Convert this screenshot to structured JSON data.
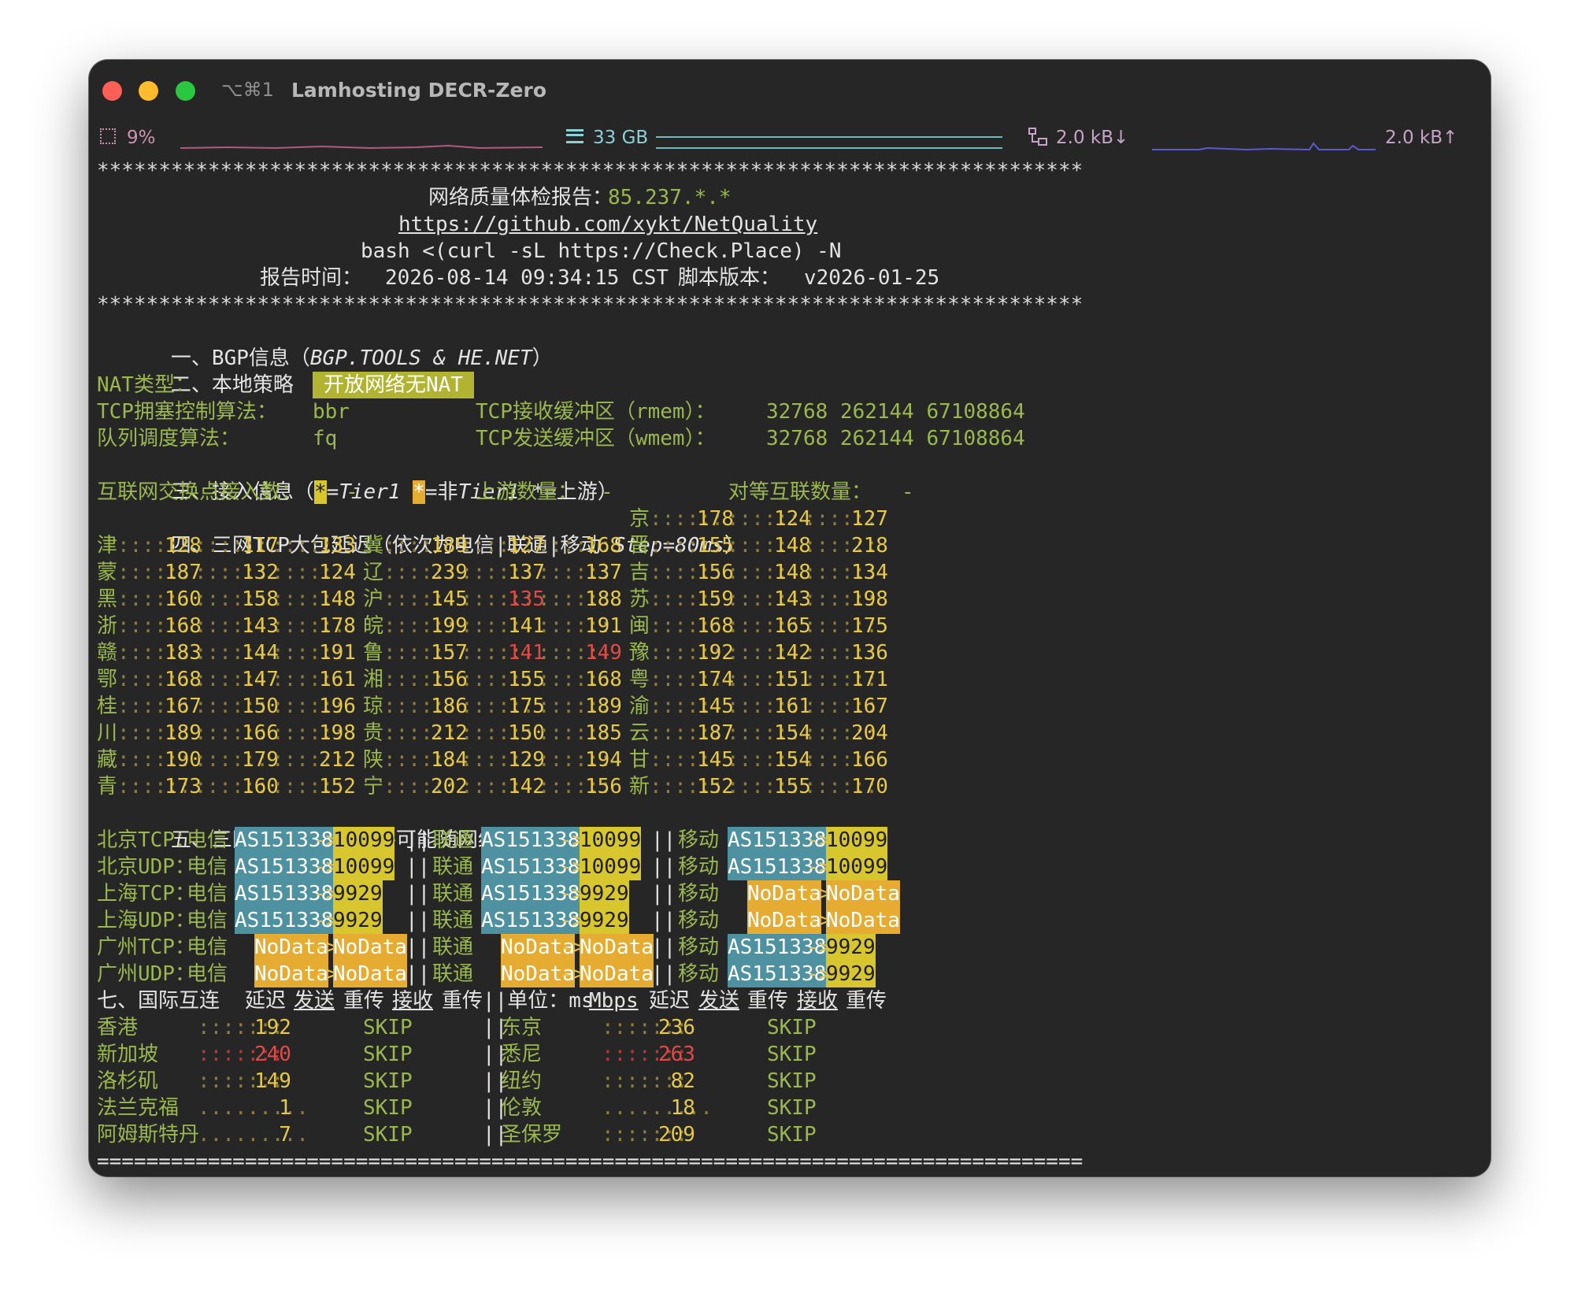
{
  "window": {
    "shortcut": "⌥⌘1",
    "title": "Lamhosting DECR-Zero"
  },
  "status": {
    "cpu": "9%",
    "memory": "33 GB",
    "net_down": "2.0 kB↓",
    "net_up": "2.0 kB↑"
  },
  "report": {
    "stars": "********************************************************************************",
    "title_label": "网络质量体检报告：",
    "title_ip": "85.237.*.*",
    "repo_url": "https://github.com/xykt/NetQuality",
    "command": "bash <(curl -sL https://Check.Place) -N",
    "report_time_label": "报告时间：",
    "report_time": "2026-08-14 09:34:15 CST",
    "version_label": "脚本版本：",
    "version": "v2026-01-25"
  },
  "sections": {
    "bgp": "一、BGP信息（",
    "bgp_src": "BGP.TOOLS & HE.NET",
    "bgp_end": "）",
    "local": "二、本地策略",
    "nat_label": "NAT类型：",
    "nat_value": "开放网络无NAT",
    "tcp_cc_label": "TCP拥塞控制算法：",
    "tcp_cc_value": "bbr",
    "rmem_label": "TCP接收缓冲区（rmem）：",
    "rmem_value": "32768 262144 67108864",
    "qdisc_label": "队列调度算法：",
    "qdisc_value": "fq",
    "wmem_label": "TCP发送缓冲区（wmem）：",
    "wmem_value": "32768 262144 67108864",
    "access": "三、接入信息（",
    "access_t1": "=Tier1 ",
    "access_nt1": "=非",
    "access_nt1b": "Tier1 ",
    "access_up": "*=上游）",
    "ixp_label": "互联网交换点接入数：",
    "ixp_value": "-",
    "upstream_label": "上游数量：",
    "upstream_value": "-",
    "peer_label": "对等互联数量：",
    "peer_value": "-",
    "latency": "四、三网TCP大包延迟（依次为电信|联通|移动 ",
    "latency_step": "Step=80ms",
    "latency_end": "）",
    "route": "五、三网回程路由（线路可能随网络负载动态变化）",
    "intl": "七、国际互连",
    "intl_cols": [
      "延迟",
      "发送",
      "重传",
      "接收",
      "重传"
    ],
    "intl_unit": "||单位：ms",
    "intl_mbps": "Mbps"
  },
  "latency": [
    {
      "p": "京",
      "v": [
        "178",
        "124",
        "127"
      ]
    },
    {
      "p": "津",
      "v": [
        "128",
        "117",
        "133"
      ]
    },
    {
      "p": "冀",
      "v": [
        "189",
        "127",
        "168"
      ]
    },
    {
      "p": "晋",
      "v": [
        "155",
        "148",
        "218"
      ]
    },
    {
      "p": "蒙",
      "v": [
        "187",
        "132",
        "124"
      ]
    },
    {
      "p": "辽",
      "v": [
        "239",
        "137",
        "137"
      ]
    },
    {
      "p": "吉",
      "v": [
        "156",
        "148",
        "134"
      ]
    },
    {
      "p": "黑",
      "v": [
        "160",
        "158",
        "148"
      ]
    },
    {
      "p": "沪",
      "v": [
        "145",
        "135",
        "188"
      ]
    },
    {
      "p": "苏",
      "v": [
        "159",
        "143",
        "198"
      ]
    },
    {
      "p": "浙",
      "v": [
        "168",
        "143",
        "178"
      ]
    },
    {
      "p": "皖",
      "v": [
        "199",
        "141",
        "191"
      ]
    },
    {
      "p": "闽",
      "v": [
        "168",
        "165",
        "175"
      ]
    },
    {
      "p": "赣",
      "v": [
        "183",
        "144",
        "191"
      ]
    },
    {
      "p": "鲁",
      "v": [
        "157",
        "141",
        "149"
      ]
    },
    {
      "p": "豫",
      "v": [
        "192",
        "142",
        "136"
      ]
    },
    {
      "p": "鄂",
      "v": [
        "168",
        "147",
        "161"
      ]
    },
    {
      "p": "湘",
      "v": [
        "156",
        "155",
        "168"
      ]
    },
    {
      "p": "粤",
      "v": [
        "174",
        "151",
        "171"
      ]
    },
    {
      "p": "桂",
      "v": [
        "167",
        "150",
        "196"
      ]
    },
    {
      "p": "琼",
      "v": [
        "186",
        "175",
        "189"
      ]
    },
    {
      "p": "渝",
      "v": [
        "145",
        "161",
        "167"
      ]
    },
    {
      "p": "川",
      "v": [
        "189",
        "166",
        "198"
      ]
    },
    {
      "p": "贵",
      "v": [
        "212",
        "150",
        "185"
      ]
    },
    {
      "p": "云",
      "v": [
        "187",
        "154",
        "204"
      ]
    },
    {
      "p": "藏",
      "v": [
        "190",
        "179",
        "212"
      ]
    },
    {
      "p": "陕",
      "v": [
        "184",
        "129",
        "194"
      ]
    },
    {
      "p": "甘",
      "v": [
        "145",
        "154",
        "166"
      ]
    },
    {
      "p": "青",
      "v": [
        "173",
        "160",
        "152"
      ]
    },
    {
      "p": "宁",
      "v": [
        "202",
        "142",
        "156"
      ]
    },
    {
      "p": "新",
      "v": [
        "152",
        "155",
        "170"
      ]
    }
  ],
  "routes": {
    "isp_ct": "电信",
    "isp_cu": "联通",
    "isp_cm": "移动",
    "sep": "||",
    "arrow": "->",
    "rows": [
      {
        "label": "北京TCP：",
        "ct": [
          "AS151338",
          "10099"
        ],
        "cu": [
          "AS151338",
          "10099"
        ],
        "cm": [
          "AS151338",
          "10099"
        ]
      },
      {
        "label": "北京UDP：",
        "ct": [
          "AS151338",
          "10099"
        ],
        "cu": [
          "AS151338",
          "10099"
        ],
        "cm": [
          "AS151338",
          "10099"
        ]
      },
      {
        "label": "上海TCP：",
        "ct": [
          "AS151338",
          "9929"
        ],
        "cu": [
          "AS151338",
          "9929"
        ],
        "cm": [
          "NoData",
          "NoData"
        ]
      },
      {
        "label": "上海UDP：",
        "ct": [
          "AS151338",
          "9929"
        ],
        "cu": [
          "AS151338",
          "9929"
        ],
        "cm": [
          "NoData",
          "NoData"
        ]
      },
      {
        "label": "广州TCP：",
        "ct": [
          "NoData",
          "NoData"
        ],
        "cu": [
          "NoData",
          "NoData"
        ],
        "cm": [
          "AS151338",
          "9929"
        ]
      },
      {
        "label": "广州UDP：",
        "ct": [
          "NoData",
          "NoData"
        ],
        "cu": [
          "NoData",
          "NoData"
        ],
        "cm": [
          "AS151338",
          "9929"
        ]
      }
    ]
  },
  "intl": [
    {
      "l": "香港",
      "lv": "192",
      "ls": "SKIP",
      "r": "东京",
      "rv": "236",
      "rs": "SKIP"
    },
    {
      "l": "新加坡",
      "lv": "240",
      "ls": "SKIP",
      "r": "悉尼",
      "rv": "263",
      "rs": "SKIP"
    },
    {
      "l": "洛杉矶",
      "lv": "149",
      "ls": "SKIP",
      "r": "纽约",
      "rv": "82",
      "rs": "SKIP"
    },
    {
      "l": "法兰克福",
      "lv": "1",
      "ls": "SKIP",
      "r": "伦敦",
      "rv": "18",
      "rs": "SKIP"
    },
    {
      "l": "阿姆斯特丹",
      "lv": "7",
      "ls": "SKIP",
      "r": "圣保罗",
      "rv": "209",
      "rs": "SKIP"
    }
  ],
  "footer_line": "================================================================================"
}
